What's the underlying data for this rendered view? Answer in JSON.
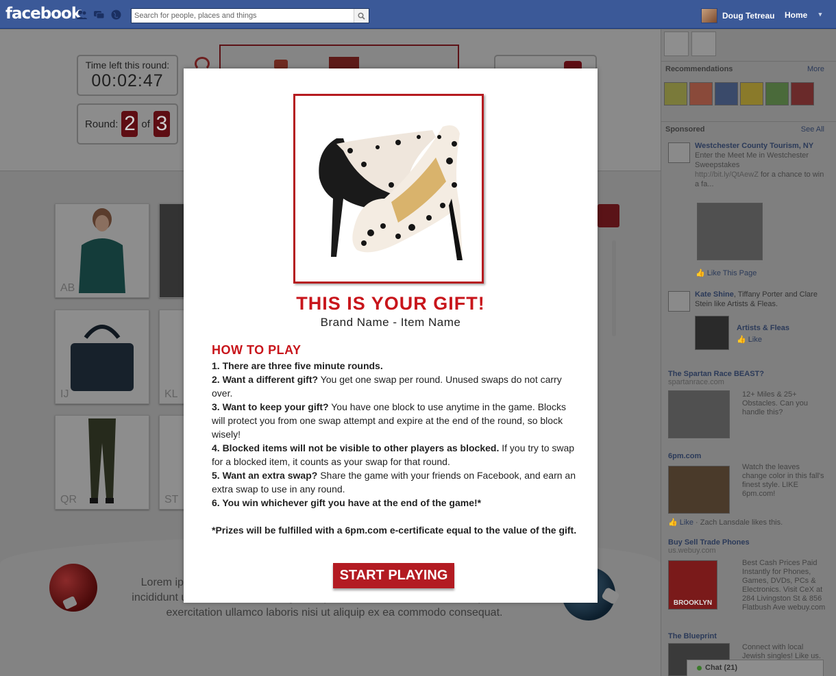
{
  "topbar": {
    "logo": "facebook",
    "search_placeholder": "Search for people, places and things",
    "user_name": "Doug Tetreau",
    "home_label": "Home"
  },
  "game": {
    "timer_label": "Time left this round:",
    "timer_value": "00:02:47",
    "round_label": "Round:",
    "round_current": "2",
    "round_of": "of",
    "round_total": "3",
    "tiles": [
      {
        "code": "AB"
      },
      {
        "code": "IJ"
      },
      {
        "code": "KL"
      },
      {
        "code": "QR"
      },
      {
        "code": "ST"
      }
    ],
    "footer_text": "Lorem ipsum dolor sit amet, consectetur adipisicing elit, sed do eiusmod tempor incididunt ut labore et dolore magna aliqua. Ut enim ad minim veniam, quis nos trud exercitation ullamco laboris nisi ut aliquip ex ea commodo consequat."
  },
  "modal": {
    "title": "THIS IS YOUR GIFT!",
    "subtitle": "Brand Name - Item Name",
    "howto_title": "HOW TO PLAY",
    "rules": [
      {
        "bold": "1. There are three five minute rounds.",
        "text": ""
      },
      {
        "bold": "2. Want a different gift?",
        "text": " You get one swap per round.  Unused swaps do not carry over."
      },
      {
        "bold": "3. Want to keep your gift?",
        "text": " You have one block to use anytime in the game.  Blocks will protect you from one swap attempt and expire at the end of the round, so block wisely!"
      },
      {
        "bold": "4. Blocked items will not be visible to other players as blocked.",
        "text": "  If you try to swap for a blocked item, it counts as your swap for that round."
      },
      {
        "bold": "5. Want an extra swap?",
        "text": "  Share the game with your friends on Facebook, and earn an extra swap to use in any round."
      },
      {
        "bold": "6. You win whichever gift you have at the end of the game!*",
        "text": ""
      }
    ],
    "disclaimer": "*Prizes will be fulfilled with a 6pm.com e-certificate equal to the value of the gift.",
    "start_button": "START PLAYING"
  },
  "sidebar": {
    "recommendations_label": "Recommendations",
    "recommendations_more": "More",
    "sponsored_label": "Sponsored",
    "sponsored_see_all": "See All",
    "ads": [
      {
        "title": "Westchester County Tourism, NY",
        "desc": "Enter the Meet Me in Westchester Sweepstakes",
        "url": "http://bit.ly/QtAewZ",
        "tail": " for a chance to win a fa...",
        "like": "Like This Page"
      },
      {
        "social": "Kate Shine",
        "social_rest": ", Tiffany Porter and Clare Stein like Artists & Fleas.",
        "page": "Artists & Fleas",
        "like": "Like"
      },
      {
        "title": "The Spartan Race BEAST?",
        "domain": "spartanrace.com",
        "desc": "12+ Miles & 25+ Obstacles. Can you handle this?"
      },
      {
        "title": "6pm.com",
        "desc": "Watch the leaves change color in this fall's finest style. LIKE 6pm.com!",
        "like": "Like",
        "like_rest": " · Zach Lansdale likes this."
      },
      {
        "title": "Buy Sell Trade Phones",
        "domain": "us.webuy.com",
        "desc": "Best Cash Prices Paid Instantly for Phones, Games, DVDs, PCs & Electronics. Visit CeX at 284 Livingston St & 856 Flatbush Ave webuy.com",
        "img_label": "BROOKLYN"
      },
      {
        "title": "The Blueprint",
        "desc": "Connect with local Jewish singles! Like us."
      }
    ],
    "chat_label": "Chat (21)"
  }
}
